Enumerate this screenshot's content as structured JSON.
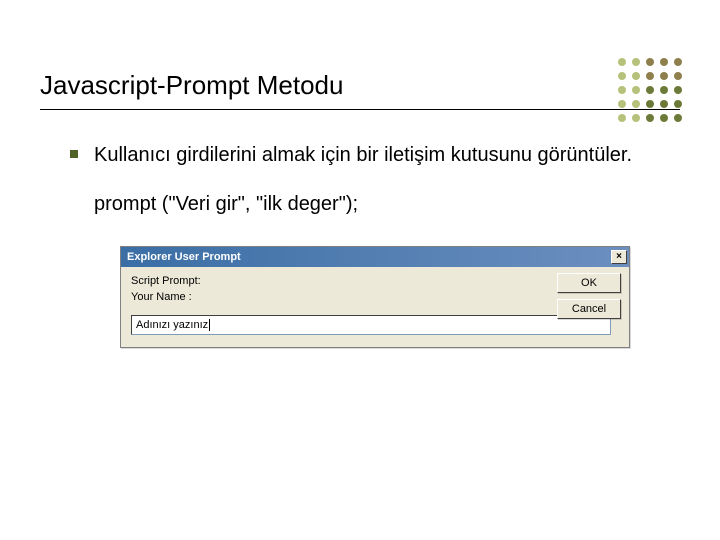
{
  "slide": {
    "title": "Javascript-Prompt Metodu",
    "bullet": "Kullanıcı girdilerini almak için bir iletişim kutusunu görüntüler.",
    "code": "prompt (\"Veri gir\", \"ilk deger\");"
  },
  "dialog": {
    "title": "Explorer User Prompt",
    "close_label": "×",
    "script_prompt_label": "Script Prompt:",
    "your_name_label": "Your Name :",
    "input_value": "Adınızı yazınız",
    "ok_label": "OK",
    "cancel_label": "Cancel"
  },
  "deco_colors": [
    "#b6c17a",
    "#b6c17a",
    "#8f7f4d",
    "#8f7f4d",
    "#8f7f4d",
    "#b6c17a",
    "#b6c17a",
    "#8f7f4d",
    "#8f7f4d",
    "#8f7f4d",
    "#b6c17a",
    "#b6c17a",
    "#6b7a37",
    "#6b7a37",
    "#6b7a37",
    "#b6c17a",
    "#b6c17a",
    "#6b7a37",
    "#6b7a37",
    "#6b7a37",
    "#b6c17a",
    "#b6c17a",
    "#6b7a37",
    "#6b7a37",
    "#6b7a37"
  ]
}
